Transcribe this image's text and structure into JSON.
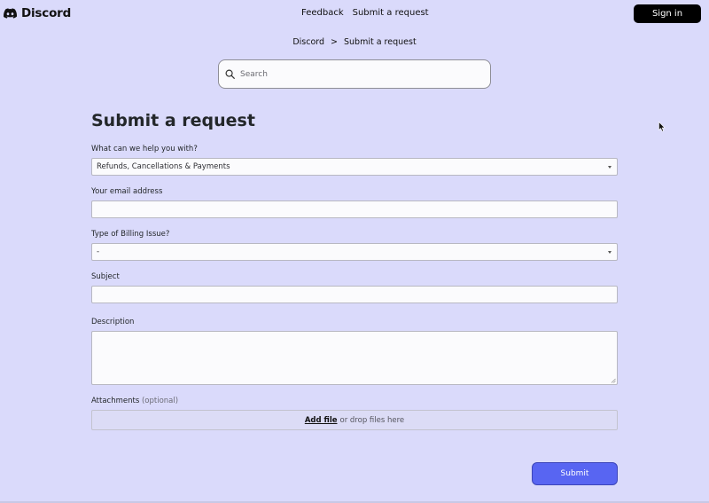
{
  "header": {
    "brand": "Discord",
    "nav": [
      "Feedback",
      "Submit a request"
    ],
    "signin_label": "Sign in"
  },
  "breadcrumb": {
    "items": [
      "Discord",
      "Submit a request"
    ],
    "separator": ">"
  },
  "search": {
    "placeholder": "Search"
  },
  "form": {
    "title": "Submit a request",
    "help_label": "What can we help you with?",
    "help_value": "Refunds, Cancellations & Payments",
    "email_label": "Your email address",
    "email_value": "",
    "billing_label": "Type of Billing Issue?",
    "billing_value": "-",
    "subject_label": "Subject",
    "subject_value": "",
    "description_label": "Description",
    "attachments_label": "Attachments",
    "attachments_optional": "(optional)",
    "add_file_label": "Add file",
    "drop_text": "or drop files here",
    "submit_label": "Submit"
  },
  "colors": {
    "background": "#dadafb",
    "accent": "#5865f2",
    "signin_bg": "#000000"
  },
  "icons": [
    "discord-logo-icon",
    "search-icon",
    "chevron-down-icon",
    "mouse-cursor-icon"
  ]
}
